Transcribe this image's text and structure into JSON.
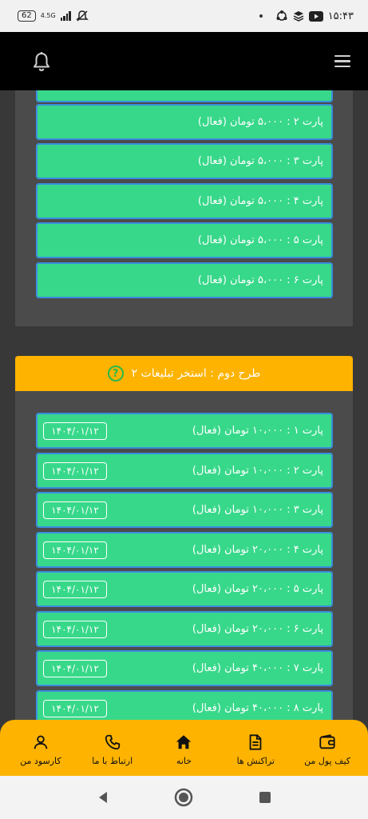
{
  "status_bar": {
    "battery": "62",
    "network": "4.5G",
    "time": "۱۵:۴۳"
  },
  "app_bar": {},
  "plan1": {
    "rows": [
      {
        "label": "پارت ۲ : ۵،۰۰۰ تومان (فعال)"
      },
      {
        "label": "پارت ۳ : ۵،۰۰۰ تومان (فعال)"
      },
      {
        "label": "پارت ۴ : ۵،۰۰۰ تومان (فعال)"
      },
      {
        "label": "پارت ۵ : ۵،۰۰۰ تومان (فعال)"
      },
      {
        "label": "پارت ۶ : ۵،۰۰۰ تومان (فعال)"
      }
    ]
  },
  "plan2": {
    "title": "طرح دوم : استخر تبلیغات ۲",
    "help_glyph": "?",
    "rows": [
      {
        "label": "پارت ۱ : ۱۰،۰۰۰ تومان (فعال)",
        "date": "۱۴۰۴/۰۱/۱۲"
      },
      {
        "label": "پارت ۲ : ۱۰،۰۰۰ تومان (فعال)",
        "date": "۱۴۰۴/۰۱/۱۲"
      },
      {
        "label": "پارت ۳ : ۱۰،۰۰۰ تومان (فعال)",
        "date": "۱۴۰۴/۰۱/۱۲"
      },
      {
        "label": "پارت ۴ : ۲۰،۰۰۰ تومان (فعال)",
        "date": "۱۴۰۴/۰۱/۱۲"
      },
      {
        "label": "پارت ۵ : ۲۰،۰۰۰ تومان (فعال)",
        "date": "۱۴۰۴/۰۱/۱۲"
      },
      {
        "label": "پارت ۶ : ۲۰،۰۰۰ تومان (فعال)",
        "date": "۱۴۰۴/۰۱/۱۲"
      },
      {
        "label": "پارت ۷ : ۴۰،۰۰۰ تومان (فعال)",
        "date": "۱۴۰۴/۰۱/۱۲"
      },
      {
        "label": "پارت ۸ : ۴۰،۰۰۰ تومان (فعال)",
        "date": "۱۴۰۴/۰۱/۱۲"
      }
    ]
  },
  "bottom_nav": {
    "items": [
      {
        "label": "کارسود من",
        "icon": "user-icon"
      },
      {
        "label": "ارتباط با ما",
        "icon": "phone-icon"
      },
      {
        "label": "خانه",
        "icon": "home-icon"
      },
      {
        "label": "تراکنش ها",
        "icon": "document-icon"
      },
      {
        "label": "کیف پول من",
        "icon": "wallet-icon"
      }
    ]
  },
  "colors": {
    "accent": "#fdb300",
    "row_green": "#38d88a",
    "row_border": "#3a8dde",
    "background": "#383838",
    "card": "#4b4b4b"
  }
}
